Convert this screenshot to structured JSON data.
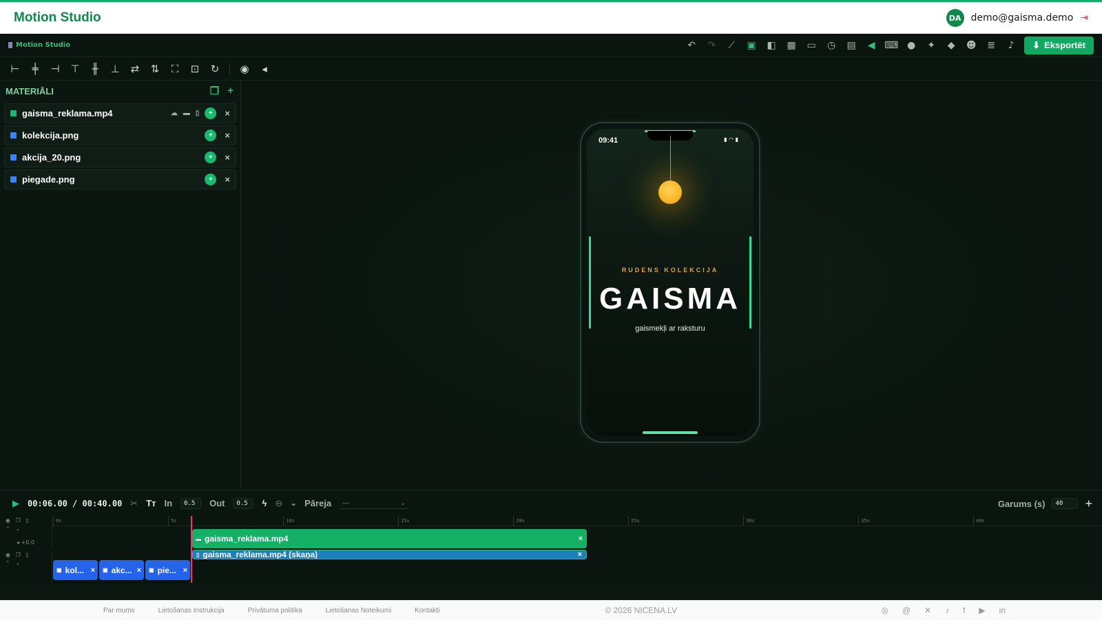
{
  "site": {
    "brand": "Motion Studio",
    "avatar_initials": "DA",
    "user_email": "demo@gaisma.demo"
  },
  "app": {
    "title": "Motion Studio",
    "export_label": "Eksportēt",
    "toolbar_icons": [
      "undo-icon",
      "redo-icon",
      "magic-wand-icon",
      "aspect-ratio-icon",
      "flip-icon",
      "grid-icon",
      "folder-icon",
      "history-icon",
      "add-file-icon",
      "volume-icon",
      "keyboard-icon",
      "palette-icon",
      "sparkles-icon",
      "layers-icon",
      "robot-icon",
      "notes-icon",
      "bell-icon"
    ]
  },
  "materials": {
    "title": "MATERIĀLI",
    "items": [
      {
        "name": "gaisma_reklama.mp4",
        "type": "video"
      },
      {
        "name": "kolekcija.png",
        "type": "image"
      },
      {
        "name": "akcija_20.png",
        "type": "image"
      },
      {
        "name": "piegade.png",
        "type": "image"
      }
    ]
  },
  "preview": {
    "time": "09:41",
    "kicker": "RUDENS KOLEKCIJA",
    "hero": "GAISMA",
    "subtitle": "gaismekļi ar raksturu"
  },
  "timeline": {
    "current": "00:06.00",
    "separator": "/",
    "total": "00:40.00",
    "in_label": "In",
    "in_value": "0.5",
    "out_label": "Out",
    "out_value": "0.5",
    "transition_label": "Pāreja",
    "transition_value": "—",
    "length_label": "Garums (s)",
    "length_value": "40",
    "ticks": [
      "0s",
      "5s",
      "10s",
      "15s",
      "20s",
      "25s",
      "30s",
      "35s",
      "40s"
    ],
    "volume_text": "+0.0",
    "clips": {
      "video": "gaisma_reklama.mp4",
      "audio": "gaisma_reklama.mp4 (skaņa)",
      "images": [
        "kol...",
        "akc...",
        "pie..."
      ]
    },
    "playhead_seconds": 6
  },
  "footer": {
    "links": [
      "Par mums",
      "Lietošanas Instrukcija",
      "Privātuma politika",
      "Lietošanas Noteikumi",
      "Kontakti"
    ],
    "copyright": "© 2026 NICENA.LV",
    "social_icons": [
      "instagram-icon",
      "threads-icon",
      "x-icon",
      "tiktok-icon",
      "facebook-icon",
      "youtube-icon",
      "linkedin-icon"
    ]
  }
}
